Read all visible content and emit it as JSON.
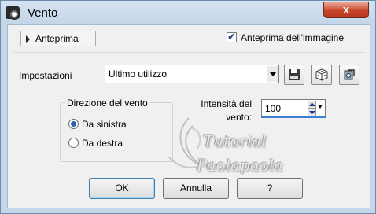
{
  "window": {
    "title": "Vento",
    "close_label": "x"
  },
  "preview": {
    "toggle_label": "Anteprima",
    "image_preview_label": "Anteprima dell'immagine",
    "image_preview_checked": true
  },
  "settings": {
    "label": "Impostazioni",
    "selected": "Ultimo utilizzo"
  },
  "direction": {
    "title": "Direzione del vento",
    "options": [
      {
        "label": "Da sinistra",
        "checked": true
      },
      {
        "label": "Da destra",
        "checked": false
      }
    ]
  },
  "intensity": {
    "label": "Intensità del vento:",
    "value": "100"
  },
  "watermark": {
    "line1": "Tutorial",
    "line2": "Paolapaola"
  },
  "buttons": {
    "ok": "OK",
    "cancel": "Annulla",
    "help": "?"
  },
  "icons": {
    "app": "camera-icon",
    "save": "save-icon",
    "random": "dice-icon",
    "reset": "reset-icon",
    "expand": "triangle-right-icon",
    "dropdown": "chevron-down-icon"
  }
}
